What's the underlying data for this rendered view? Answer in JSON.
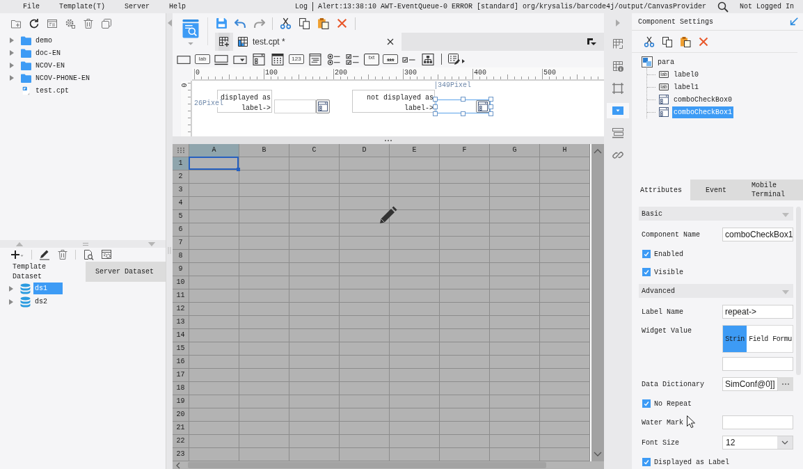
{
  "menu_bar": {
    "items": [
      "File",
      "Template(T)",
      "Server",
      "Help"
    ],
    "log": "Log",
    "alert": "Alert:13:38:10 AWT-EventQueue-0 ERROR [standard] org/krysalis/barcode4j/output/CanvasProvider",
    "login_status": "Not Logged In"
  },
  "template_tree": {
    "items": [
      {
        "label": "demo",
        "kind": "folder"
      },
      {
        "label": "doc-EN",
        "kind": "folder"
      },
      {
        "label": "NCOV-EN",
        "kind": "folder"
      },
      {
        "label": "NCOV-PHONE-EN",
        "kind": "folder"
      },
      {
        "label": "test.cpt",
        "kind": "file"
      }
    ]
  },
  "dataset_panel": {
    "tabs": [
      {
        "label": "Template Dataset",
        "selected": true
      },
      {
        "label": "Server Dataset",
        "selected": false
      }
    ],
    "items": [
      {
        "label": "ds1",
        "selected": true
      },
      {
        "label": "ds2",
        "selected": false
      }
    ]
  },
  "editor_tabs": [
    {
      "label": "test.cpt *",
      "selected": true
    }
  ],
  "widget_toolbar": [
    {
      "kind": "textbox"
    },
    {
      "kind": "label",
      "glyph": "lab"
    },
    {
      "kind": "button"
    },
    {
      "kind": "combobox"
    },
    {
      "kind": "combocheckbox"
    },
    {
      "kind": "date"
    },
    {
      "kind": "number",
      "glyph": "123"
    },
    {
      "kind": "textarea"
    },
    {
      "kind": "radiogroup"
    },
    {
      "kind": "checkboxgroup"
    },
    {
      "kind": "text",
      "glyph": "txt"
    },
    {
      "kind": "password",
      "glyph": "***"
    },
    {
      "kind": "checkbox"
    },
    {
      "kind": "tree"
    },
    {
      "kind": "more"
    }
  ],
  "parameter_canvas": {
    "ruler_labels": [
      "0",
      "100",
      "200",
      "300",
      "400",
      "500"
    ],
    "vertical_ruler_label": "0",
    "left_offset": "26Pixel",
    "top_offset": "349Pixel",
    "widgets": [
      {
        "kind": "label",
        "text": "displayed as label->",
        "selected": false
      },
      {
        "kind": "combo",
        "selected": false
      },
      {
        "kind": "label",
        "text": "not displayed as label->",
        "selected": false
      },
      {
        "kind": "combo",
        "selected": true
      }
    ]
  },
  "sheet": {
    "disabled": true,
    "columns": [
      {
        "label": "A",
        "selected": true
      },
      {
        "label": "B",
        "selected": false
      },
      {
        "label": "C",
        "selected": false
      },
      {
        "label": "D",
        "selected": false
      },
      {
        "label": "E",
        "selected": false
      },
      {
        "label": "F",
        "selected": false
      },
      {
        "label": "G",
        "selected": false
      },
      {
        "label": "H",
        "selected": false
      }
    ],
    "rows": [
      {
        "label": "1",
        "selected": true
      },
      {
        "label": "2",
        "selected": false
      },
      {
        "label": "3",
        "selected": false
      },
      {
        "label": "4",
        "selected": false
      },
      {
        "label": "5",
        "selected": false
      },
      {
        "label": "6",
        "selected": false
      },
      {
        "label": "7",
        "selected": false
      },
      {
        "label": "8",
        "selected": false
      },
      {
        "label": "9",
        "selected": false
      },
      {
        "label": "10",
        "selected": false
      },
      {
        "label": "11",
        "selected": false
      },
      {
        "label": "12",
        "selected": false
      },
      {
        "label": "13",
        "selected": false
      },
      {
        "label": "14",
        "selected": false
      },
      {
        "label": "15",
        "selected": false
      },
      {
        "label": "16",
        "selected": false
      },
      {
        "label": "17",
        "selected": false
      },
      {
        "label": "18",
        "selected": false
      },
      {
        "label": "19",
        "selected": false
      },
      {
        "label": "20",
        "selected": false
      },
      {
        "label": "21",
        "selected": false
      },
      {
        "label": "22",
        "selected": false
      },
      {
        "label": "23",
        "selected": false
      }
    ]
  },
  "side_tools": [
    {
      "kind": "cell-attributes",
      "selected": false
    },
    {
      "kind": "cell-info",
      "selected": false
    },
    {
      "kind": "frame",
      "selected": false
    },
    {
      "kind": "widget",
      "selected": true
    },
    {
      "kind": "layers",
      "selected": false
    },
    {
      "kind": "link",
      "selected": false
    }
  ],
  "component_settings": {
    "title": "Component Settings",
    "tree": {
      "label": "para",
      "kind": "pane",
      "selected": false,
      "children": [
        {
          "label": "label0",
          "kind": "label",
          "glyph": "lab",
          "selected": false
        },
        {
          "label": "label1",
          "kind": "label",
          "glyph": "lab",
          "selected": false
        },
        {
          "label": "comboCheckBox0",
          "kind": "combocheckbox",
          "selected": false
        },
        {
          "label": "comboCheckBox1",
          "kind": "combocheckbox",
          "selected": true
        }
      ]
    }
  },
  "property_tabs": [
    {
      "label": "Attributes",
      "selected": true
    },
    {
      "label": "Event",
      "selected": false
    },
    {
      "label": "Mobile Terminal",
      "selected": false
    }
  ],
  "properties": [
    {
      "kind": "section",
      "label": "Basic",
      "expanded": true
    },
    {
      "kind": "text",
      "label": "Component Name",
      "value": "comboCheckBox1"
    },
    {
      "kind": "checkbox",
      "label": "Enabled",
      "checked": true
    },
    {
      "kind": "checkbox",
      "label": "Visible",
      "checked": true
    },
    {
      "kind": "section",
      "label": "Advanced",
      "expanded": true
    },
    {
      "kind": "text",
      "label": "Label Name",
      "value": "repeat->"
    },
    {
      "kind": "segmented",
      "label": "Widget Value",
      "options": [
        {
          "label": "Strin",
          "selected": true
        },
        {
          "label": "Field",
          "selected": false
        },
        {
          "label": "Formu",
          "selected": false
        }
      ]
    },
    {
      "kind": "picker",
      "label": "Data Dictionary",
      "value": "SimConf@0]]"
    },
    {
      "kind": "checkbox",
      "label": "No Repeat",
      "checked": true
    },
    {
      "kind": "text",
      "label": "Water Mark"
    },
    {
      "kind": "select",
      "label": "Font Size",
      "value": "12"
    },
    {
      "kind": "checkbox",
      "label": "Displayed as Label",
      "checked": true
    }
  ]
}
